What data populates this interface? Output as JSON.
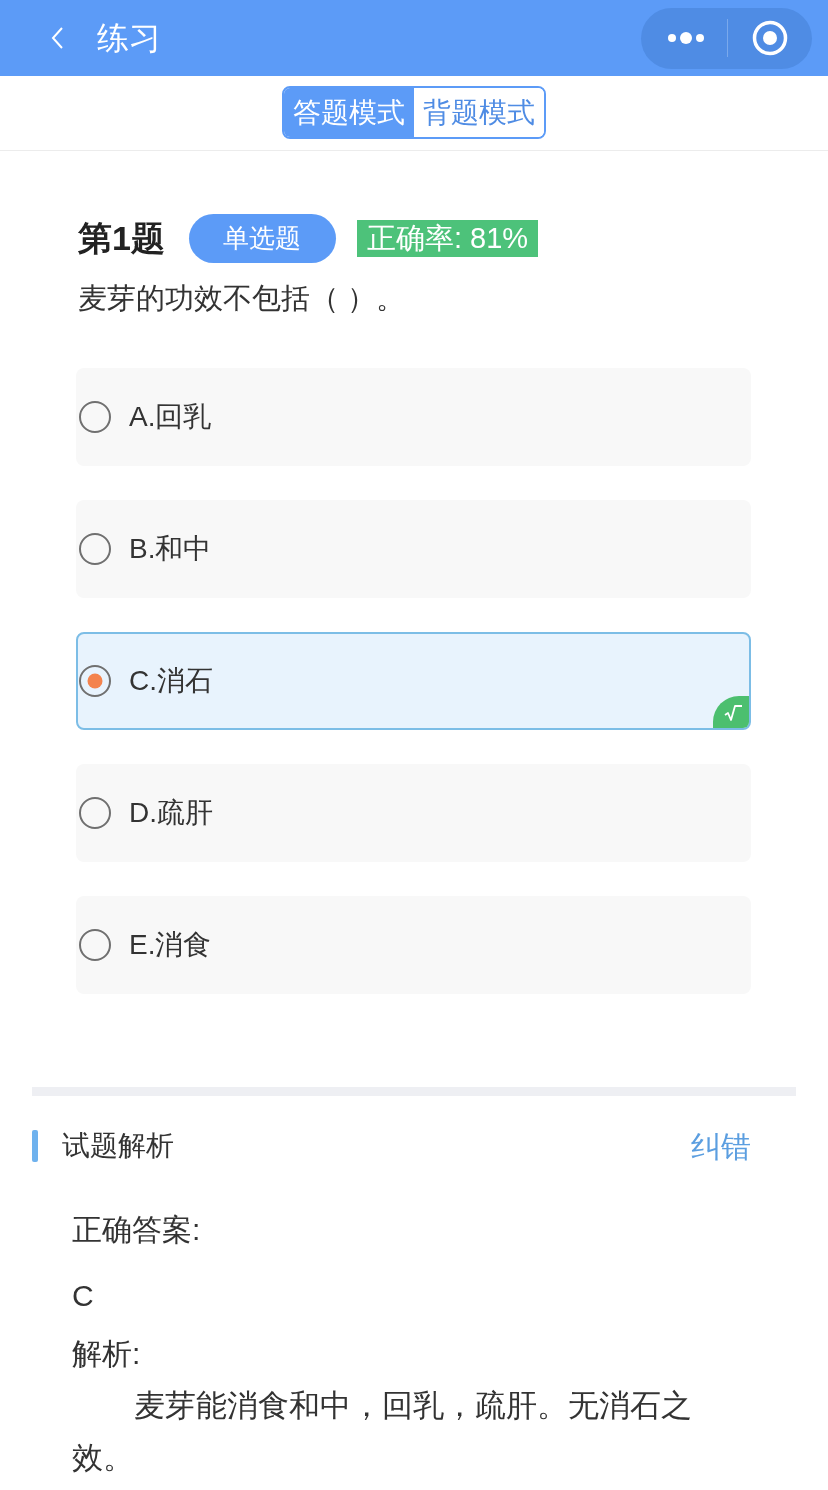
{
  "header": {
    "title": "练习"
  },
  "mode_tabs": [
    {
      "label": "答题模式",
      "selected": true
    },
    {
      "label": "背题模式",
      "selected": false
    }
  ],
  "question": {
    "number": "第1题",
    "type_badge": "单选题",
    "accuracy": "正确率: 81%",
    "text": "麦芽的功效不包括（ ）。"
  },
  "options": [
    {
      "label": "A.回乳",
      "selected": false,
      "correct": false
    },
    {
      "label": "B.和中",
      "selected": false,
      "correct": false
    },
    {
      "label": "C.消石",
      "selected": true,
      "correct": true
    },
    {
      "label": "D.疏肝",
      "selected": false,
      "correct": false
    },
    {
      "label": "E.消食",
      "selected": false,
      "correct": false
    }
  ],
  "analysis": {
    "title": "试题解析",
    "report_link": "纠错",
    "answer_label": "正确答案:",
    "answer": "C",
    "explanation_label": "解析:",
    "explanation": "麦芽能消食和中，回乳，疏肝。无消石之效。"
  }
}
